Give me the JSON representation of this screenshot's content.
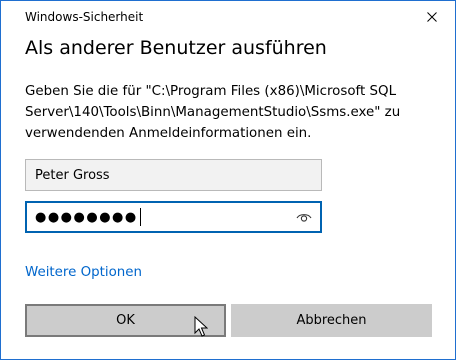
{
  "window": {
    "title": "Windows-Sicherheit",
    "close_icon": "close-icon"
  },
  "dialog": {
    "heading": "Als anderer Benutzer ausführen",
    "message_lines": [
      "Geben Sie die für \"C:\\Program Files (x86)\\Microsoft SQL",
      "Server\\140\\Tools\\Binn\\ManagementStudio\\Ssms.exe\" zu",
      "verwendenden Anmeldeinformationen ein."
    ]
  },
  "form": {
    "username_value": "Peter Gross",
    "password_masked": "●●●●●●●●",
    "reveal_icon": "eye-icon"
  },
  "links": {
    "more_options": "Weitere Optionen"
  },
  "buttons": {
    "ok_label": "OK",
    "cancel_label": "Abbrechen"
  },
  "colors": {
    "accent": "#0063b1",
    "link": "#0066cc",
    "button_bg": "#cccccc",
    "window_border": "#1f6fd0"
  }
}
